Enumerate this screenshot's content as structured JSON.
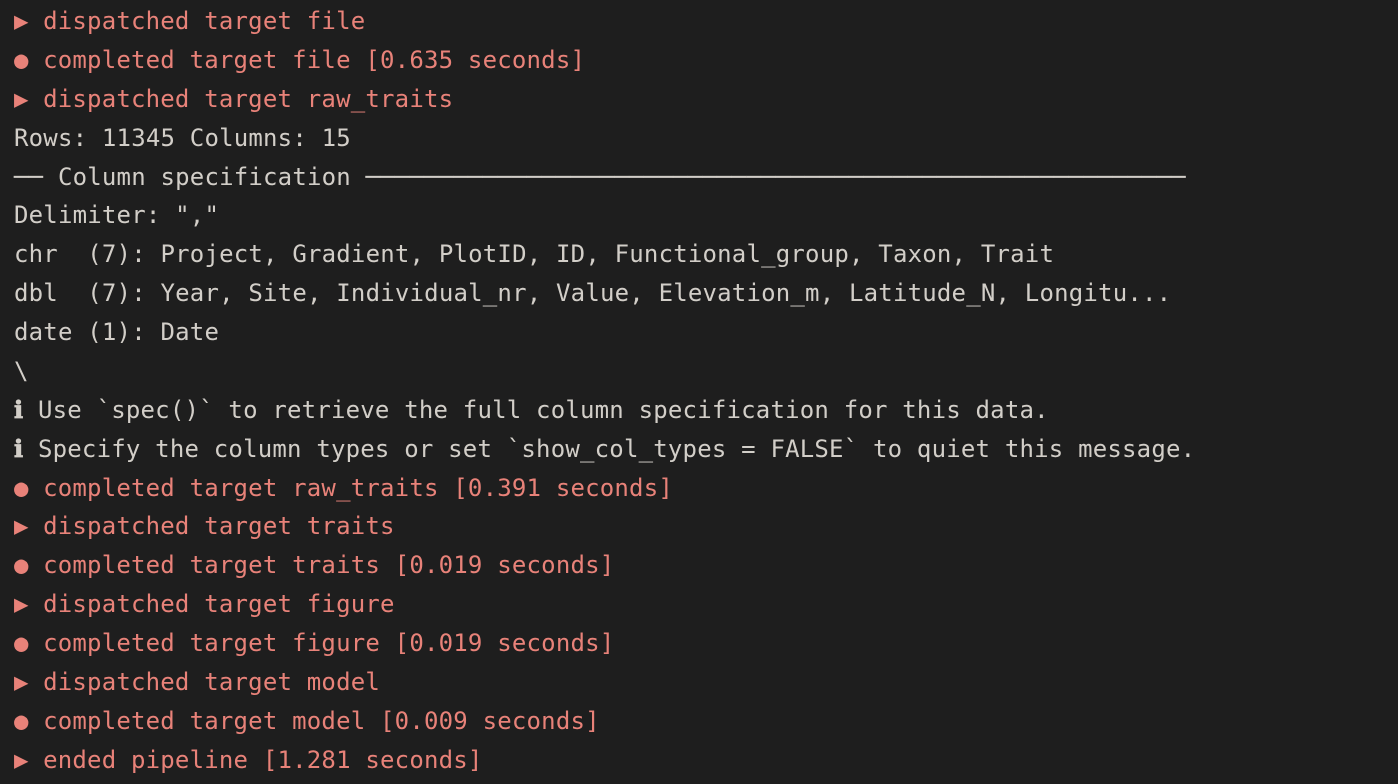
{
  "lines": [
    {
      "type": "status",
      "icon": "▶",
      "text": "dispatched target file"
    },
    {
      "type": "status",
      "icon": "●",
      "text": "completed target file [0.635 seconds]"
    },
    {
      "type": "status",
      "icon": "▶",
      "text": "dispatched target raw_traits"
    },
    {
      "type": "plain",
      "text": "Rows: 11345 Columns: 15"
    },
    {
      "type": "rule",
      "text": "── Column specification ────────────────────────────────────────────────────────"
    },
    {
      "type": "plain",
      "text": "Delimiter: \",\""
    },
    {
      "type": "plain",
      "text": "chr  (7): Project, Gradient, PlotID, ID, Functional_group, Taxon, Trait"
    },
    {
      "type": "plain",
      "text": "dbl  (7): Year, Site, Individual_nr, Value, Elevation_m, Latitude_N, Longitu..."
    },
    {
      "type": "plain",
      "text": "date (1): Date"
    },
    {
      "type": "spinner",
      "text": "\\"
    },
    {
      "type": "info",
      "text": "Use `spec()` to retrieve the full column specification for this data."
    },
    {
      "type": "info",
      "text": "Specify the column types or set `show_col_types = FALSE` to quiet this message."
    },
    {
      "type": "status",
      "icon": "●",
      "text": "completed target raw_traits [0.391 seconds]"
    },
    {
      "type": "status",
      "icon": "▶",
      "text": "dispatched target traits"
    },
    {
      "type": "status",
      "icon": "●",
      "text": "completed target traits [0.019 seconds]"
    },
    {
      "type": "status",
      "icon": "▶",
      "text": "dispatched target figure"
    },
    {
      "type": "status",
      "icon": "●",
      "text": "completed target figure [0.019 seconds]"
    },
    {
      "type": "status",
      "icon": "▶",
      "text": "dispatched target model"
    },
    {
      "type": "status",
      "icon": "●",
      "text": "completed target model [0.009 seconds]"
    },
    {
      "type": "status",
      "icon": "▶",
      "text": "ended pipeline [1.281 seconds]"
    }
  ],
  "icons": {
    "info": "ℹ"
  }
}
